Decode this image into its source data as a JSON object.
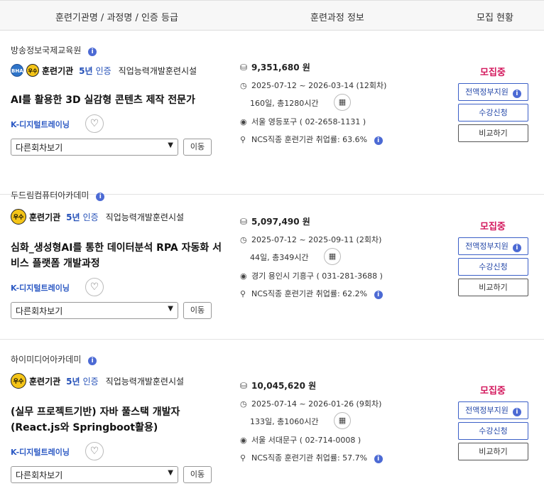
{
  "header": {
    "col1": "훈련기관명 / 과정명 / 인증 등급",
    "col2": "훈련과정 정보",
    "col3": "모집 현황"
  },
  "common": {
    "info_mark": "i",
    "cert_badge": "우수",
    "cert_name": "훈련기관",
    "cert_years": "5년",
    "cert_label": "인증",
    "cert_type": "직업능력개발훈련시설",
    "tag": "K-디지털트레이닝",
    "select_value": "다른회차보기",
    "move_label": "이동",
    "status": "모집중",
    "funding_label": "전액정부지원",
    "apply_label": "수강신청",
    "compare_label": "비교하기"
  },
  "icons": {
    "money": "coin-stack-icon",
    "clock": "clock-icon",
    "location": "location-pin-icon",
    "person": "person-icon",
    "calendar": "calendar-icon",
    "heart": "heart-icon",
    "caret": "chevron-down-icon"
  },
  "colors": {
    "accent_blue": "#2d5ac4",
    "status_pink": "#d3185d",
    "info_blue": "#4c6ad4",
    "badge_yellow": "#f5c518"
  },
  "courses": [
    {
      "institution": "방송정보국제교육원",
      "extra_badge": "BHA",
      "title": "AI를 활용한 3D 실감형 콘텐츠 제작 전문가",
      "price": "9,351,680 원",
      "period": "2025-07-12 ~ 2026-03-14 (12회차)",
      "hours": "160일, 총1280시간",
      "location": "서울 영등포구 ( 02-2658-1131 )",
      "ncs": "NCS직종 훈련기관 취업률: 63.6%"
    },
    {
      "institution": "두드림컴퓨터아카데미",
      "title": "심화_생성형AI를 통한 데이터분석 RPA 자동화 서비스 플랫폼 개발과정",
      "price": "5,097,490 원",
      "period": "2025-07-12 ~ 2025-09-11 (2회차)",
      "hours": "44일, 총349시간",
      "location": "경기 용인시 기흥구 ( 031-281-3688 )",
      "ncs": "NCS직종 훈련기관 취업률: 62.2%"
    },
    {
      "institution": "하이미디어아카데미",
      "title": "(실무 프로젝트기반) 자바 풀스택 개발자(React.js와 Springboot활용)",
      "price": "10,045,620 원",
      "period": "2025-07-14 ~ 2026-01-26 (9회차)",
      "hours": "133일, 총1060시간",
      "location": "서울 서대문구 ( 02-714-0008 )",
      "ncs": "NCS직종 훈련기관 취업률: 57.7%"
    }
  ]
}
